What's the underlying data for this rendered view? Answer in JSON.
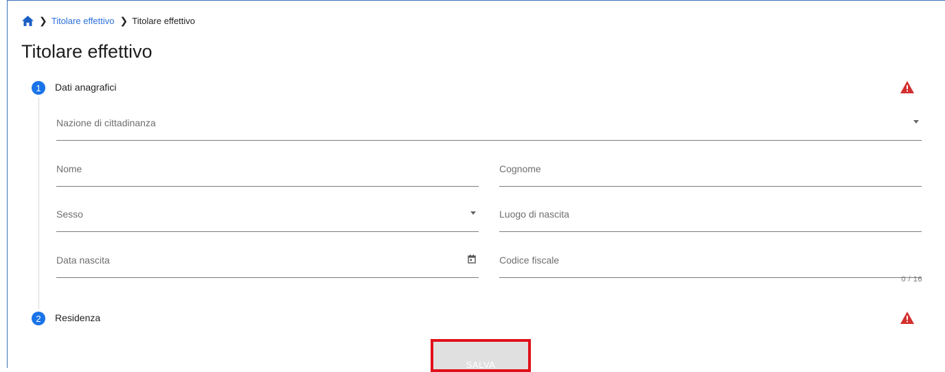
{
  "breadcrumb": {
    "items": [
      {
        "label": "Titolare effettivo",
        "link": true
      },
      {
        "label": "Titolare effettivo",
        "link": false
      }
    ]
  },
  "page": {
    "title": "Titolare effettivo"
  },
  "steps": [
    {
      "number": "1",
      "label": "Dati anagrafici",
      "status": "error"
    },
    {
      "number": "2",
      "label": "Residenza",
      "status": "error"
    }
  ],
  "form": {
    "nazione": {
      "placeholder": "Nazione di cittadinanza",
      "value": ""
    },
    "nome": {
      "placeholder": "Nome",
      "value": ""
    },
    "cognome": {
      "placeholder": "Cognome",
      "value": ""
    },
    "sesso": {
      "placeholder": "Sesso",
      "value": ""
    },
    "luogo": {
      "placeholder": "Luogo di nascita",
      "value": ""
    },
    "data": {
      "placeholder": "Data nascita",
      "value": ""
    },
    "codice": {
      "placeholder": "Codice fiscale",
      "value": "",
      "counter": "0 / 16"
    }
  },
  "actions": {
    "save_label": "SALVA"
  },
  "colors": {
    "accent": "#1a73e8",
    "link": "#2a6fdb",
    "warning": "#d32f2f",
    "highlight": "#e0101a"
  }
}
